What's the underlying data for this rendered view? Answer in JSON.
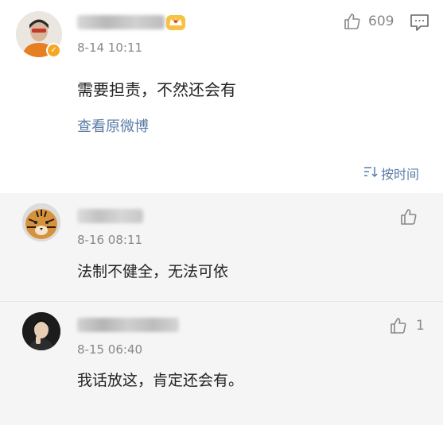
{
  "main_comment": {
    "timestamp": "8-14 10:11",
    "text": "需要担责，不然还会有",
    "view_original_link": "查看原微博",
    "like_count": "609"
  },
  "sort_label": "按时间",
  "replies": [
    {
      "timestamp": "8-16 08:11",
      "text": "法制不健全，无法可依",
      "like_count": ""
    },
    {
      "timestamp": "8-15 06:40",
      "text": "我话放这，肯定还会有。",
      "like_count": "1"
    }
  ],
  "colors": {
    "link": "#5b7ca6",
    "muted": "#888888",
    "reply_bg": "#f5f5f5",
    "verified_badge": "#f5a623"
  },
  "icons": [
    "verified-icon",
    "crown-icon",
    "thumbs-up-icon",
    "comment-icon",
    "sort-icon"
  ]
}
